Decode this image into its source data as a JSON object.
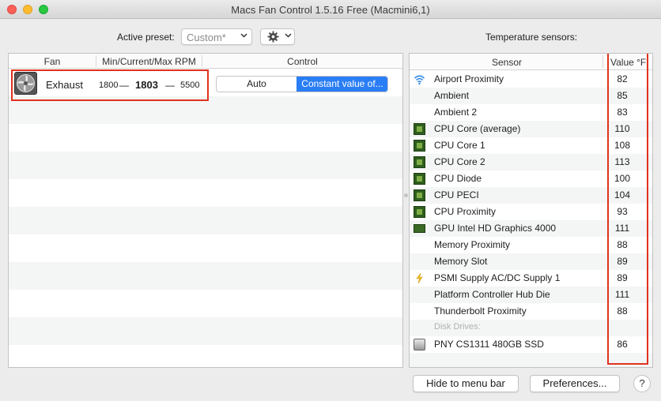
{
  "window": {
    "title": "Macs Fan Control 1.5.16 Free (Macmini6,1)"
  },
  "toolbar": {
    "preset_label": "Active preset:",
    "preset_value": "Custom*",
    "gear_icon": "gear-icon",
    "temperature_label": "Temperature sensors:"
  },
  "fans": {
    "columns": [
      "Fan",
      "Min/Current/Max RPM",
      "Control"
    ],
    "rows": [
      {
        "name": "Exhaust",
        "min_rpm": "1800",
        "current_rpm": "1803",
        "max_rpm": "5500",
        "separator": "—",
        "control_options": [
          "Auto",
          "Constant value of..."
        ],
        "selected_control": "Constant value of..."
      }
    ]
  },
  "sensors": {
    "columns": [
      "Sensor",
      "Value °F"
    ],
    "rows": [
      {
        "icon": "wifi-icon",
        "name": "Airport Proximity",
        "value": "82"
      },
      {
        "icon": "",
        "name": "Ambient",
        "value": "85"
      },
      {
        "icon": "",
        "name": "Ambient 2",
        "value": "83"
      },
      {
        "icon": "cpu-chip-icon",
        "name": "CPU Core (average)",
        "value": "110"
      },
      {
        "icon": "cpu-chip-icon",
        "name": "CPU Core 1",
        "value": "108"
      },
      {
        "icon": "cpu-chip-icon",
        "name": "CPU Core 2",
        "value": "113"
      },
      {
        "icon": "cpu-chip-icon",
        "name": "CPU Diode",
        "value": "100"
      },
      {
        "icon": "cpu-chip-icon",
        "name": "CPU PECI",
        "value": "104"
      },
      {
        "icon": "cpu-chip-icon",
        "name": "CPU Proximity",
        "value": "93"
      },
      {
        "icon": "gpu-card-icon",
        "name": "GPU Intel HD Graphics 4000",
        "value": "111"
      },
      {
        "icon": "",
        "name": "Memory Proximity",
        "value": "88"
      },
      {
        "icon": "",
        "name": "Memory Slot",
        "value": "89"
      },
      {
        "icon": "lightning-icon",
        "name": "PSMI Supply AC/DC Supply 1",
        "value": "89"
      },
      {
        "icon": "",
        "name": "Platform Controller Hub Die",
        "value": "111"
      },
      {
        "icon": "",
        "name": "Thunderbolt Proximity",
        "value": "88"
      },
      {
        "icon": "",
        "name": "Disk Drives:",
        "value": ""
      },
      {
        "icon": "disk-drive-icon",
        "name": "PNY CS1311 480GB SSD",
        "value": "86"
      }
    ]
  },
  "buttons": {
    "hide_menu_bar": "Hide to menu bar",
    "preferences": "Preferences...",
    "help": "?"
  },
  "colors": {
    "accent": "#2a7ef5",
    "highlight_box": "#e0321e"
  }
}
